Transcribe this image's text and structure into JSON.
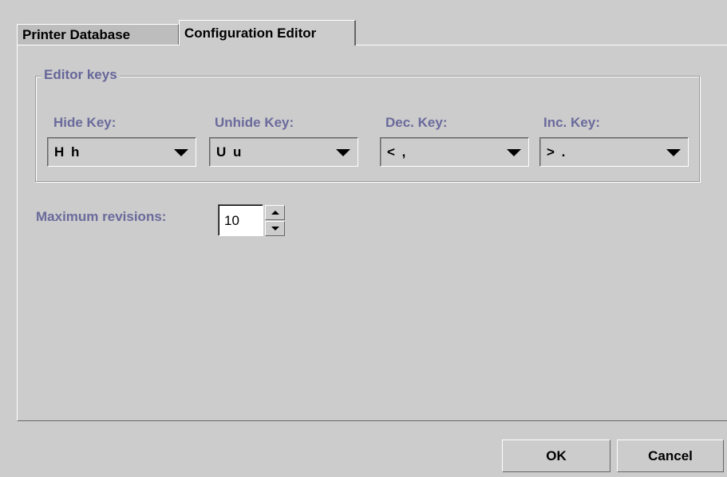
{
  "tabs": [
    {
      "label": "Printer Database",
      "selected": false
    },
    {
      "label": "Configuration Editor",
      "selected": true
    }
  ],
  "editor_keys": {
    "group_title": "Editor keys",
    "keys": [
      {
        "label": "Hide Key:",
        "value": "H h"
      },
      {
        "label": "Unhide Key:",
        "value": "U u"
      },
      {
        "label": "Dec. Key:",
        "value": "< ,"
      },
      {
        "label": "Inc. Key:",
        "value": "> ."
      }
    ]
  },
  "max_revisions": {
    "label": "Maximum revisions:",
    "value": "10"
  },
  "buttons": {
    "ok": "OK",
    "cancel": "Cancel"
  },
  "colors": {
    "background": "#cccccc",
    "label_accent": "#6a6a9c"
  }
}
